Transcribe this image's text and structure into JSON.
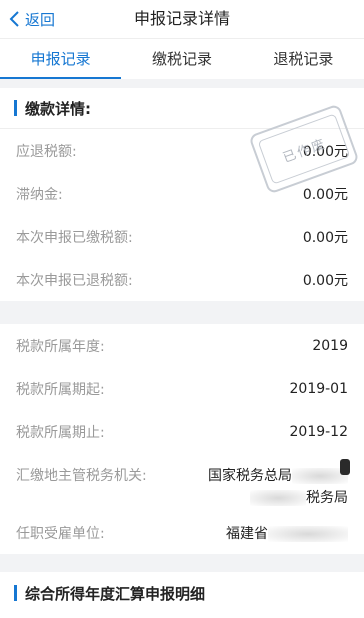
{
  "nav": {
    "back_label": "返回",
    "title": "申报记录详情"
  },
  "tabs": [
    {
      "label": "申报记录",
      "active": true
    },
    {
      "label": "缴税记录",
      "active": false
    },
    {
      "label": "退税记录",
      "active": false
    }
  ],
  "payment": {
    "section_title": "缴款详情:",
    "stamp_text": "已作废",
    "rows": [
      {
        "label": "应退税额:",
        "value": "0.00元"
      },
      {
        "label": "滞纳金:",
        "value": "0.00元"
      },
      {
        "label": "本次申报已缴税额:",
        "value": "0.00元"
      },
      {
        "label": "本次申报已退税额:",
        "value": "0.00元"
      }
    ]
  },
  "period": {
    "rows": [
      {
        "label": "税款所属年度:",
        "value": "2019"
      },
      {
        "label": "税款所属期起:",
        "value": "2019-01"
      },
      {
        "label": "税款所属期止:",
        "value": "2019-12"
      }
    ],
    "authority": {
      "label": "汇缴地主管税务机关:",
      "line1": "国家税务总局",
      "line2": "税务局"
    },
    "employer": {
      "label": "任职受雇单位:",
      "value": "福建省"
    }
  },
  "detail": {
    "section_title": "综合所得年度汇算申报明细"
  },
  "colors": {
    "accent": "#1677d2",
    "background": "#f2f3f5"
  }
}
